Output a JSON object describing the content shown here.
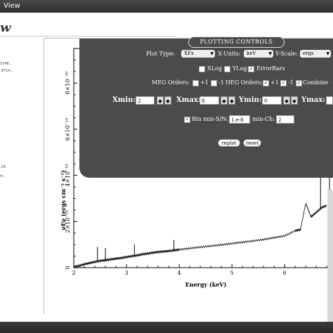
{
  "menubar": {
    "items": [
      "View"
    ]
  },
  "window": {
    "title": "w"
  },
  "sidebar": {
    "lines": [
      "3746...",
      ".9714...",
      "",
      "",
      "",
      "",
      "",
      ".24",
      "m"
    ]
  },
  "controls": {
    "title": "PLOTTING CONTROLS",
    "plot_type_label": "Plot Type:",
    "plot_type_value": "XFx",
    "x_units_label": "X-Units:",
    "x_units_value": "keV",
    "y_scale_label": "Y-Scale:",
    "y_scale_value": "ergs",
    "xlog_label": "XLog",
    "ylog_label": "YLog",
    "errorbars_label": "ErrorBars",
    "errorbars_checked": true,
    "meg_label": "MEG Orders:",
    "meg_plus": "+1",
    "meg_minus": "-1",
    "heg_label": "HEG Orders:",
    "heg_plus": "+1",
    "heg_minus": "-1",
    "combine_label": "Combine",
    "xmin_label": "Xmin:",
    "xmin_value": "2",
    "xmax_label": "Xmax:",
    "xmax_value": "8",
    "ymin_label": "Ymin:",
    "ymin_value": "0",
    "ymax_label": "Ymax:",
    "bin_label": "Bin min-S/N:",
    "bin_value": "1.e-8",
    "minch_label": "min-Ch:",
    "minch_value": "2",
    "replot_label": "replot",
    "reset_label": "reset"
  },
  "chart_data": {
    "type": "line",
    "xlabel": "Energy (keV)",
    "ylabel": "νFν (ergs cm⁻² s⁻¹)",
    "x_ticks": [
      "2",
      "3",
      "4",
      "5",
      "6"
    ],
    "y_ticks": [
      "0",
      "2×10⁻¹⁰",
      "4×10⁻¹⁰",
      "6×10⁻¹⁰",
      "8×10⁻¹⁰"
    ],
    "xlim": [
      2,
      6.85
    ],
    "ylim": [
      0,
      9.5e-10
    ],
    "series": [
      {
        "x": [
          2.0,
          2.1,
          2.2,
          2.3,
          2.4,
          2.5,
          2.6,
          2.7,
          2.8,
          2.9,
          3.0,
          3.1,
          3.2,
          3.3,
          3.4,
          3.5,
          3.6,
          3.7,
          3.8,
          3.9,
          4.0,
          4.2,
          4.4,
          4.6,
          4.8,
          5.0,
          5.2,
          5.4,
          5.6,
          5.8,
          6.0,
          6.2,
          6.3,
          6.4,
          6.5,
          6.6,
          6.7,
          6.8
        ],
        "y": [
          3e-12,
          8e-12,
          1.5e-11,
          2e-11,
          2.5e-11,
          3e-11,
          3.2e-11,
          3.6e-11,
          3.9e-11,
          4.2e-11,
          4.6e-11,
          5e-11,
          5.3e-11,
          5.8e-11,
          6.1e-11,
          6.5e-11,
          6.8e-11,
          7e-11,
          7.2e-11,
          7.5e-11,
          7.8e-11,
          8.4e-11,
          8.9e-11,
          9.4e-11,
          9.9e-11,
          1.05e-10,
          1.1e-10,
          1.16e-10,
          1.22e-10,
          1.3e-10,
          1.38e-10,
          1.6e-10,
          1.65e-10,
          2.8e-10,
          2.2e-10,
          2.4e-10,
          2.6e-10,
          2.7e-10
        ]
      }
    ],
    "spikes": [
      {
        "x": 2.45,
        "y": 9e-11
      },
      {
        "x": 2.6,
        "y": 8.5e-11
      },
      {
        "x": 3.15,
        "y": 1e-10
      },
      {
        "x": 3.9,
        "y": 1.2e-10
      },
      {
        "x": 6.68,
        "y": 4.6e-10
      }
    ]
  }
}
